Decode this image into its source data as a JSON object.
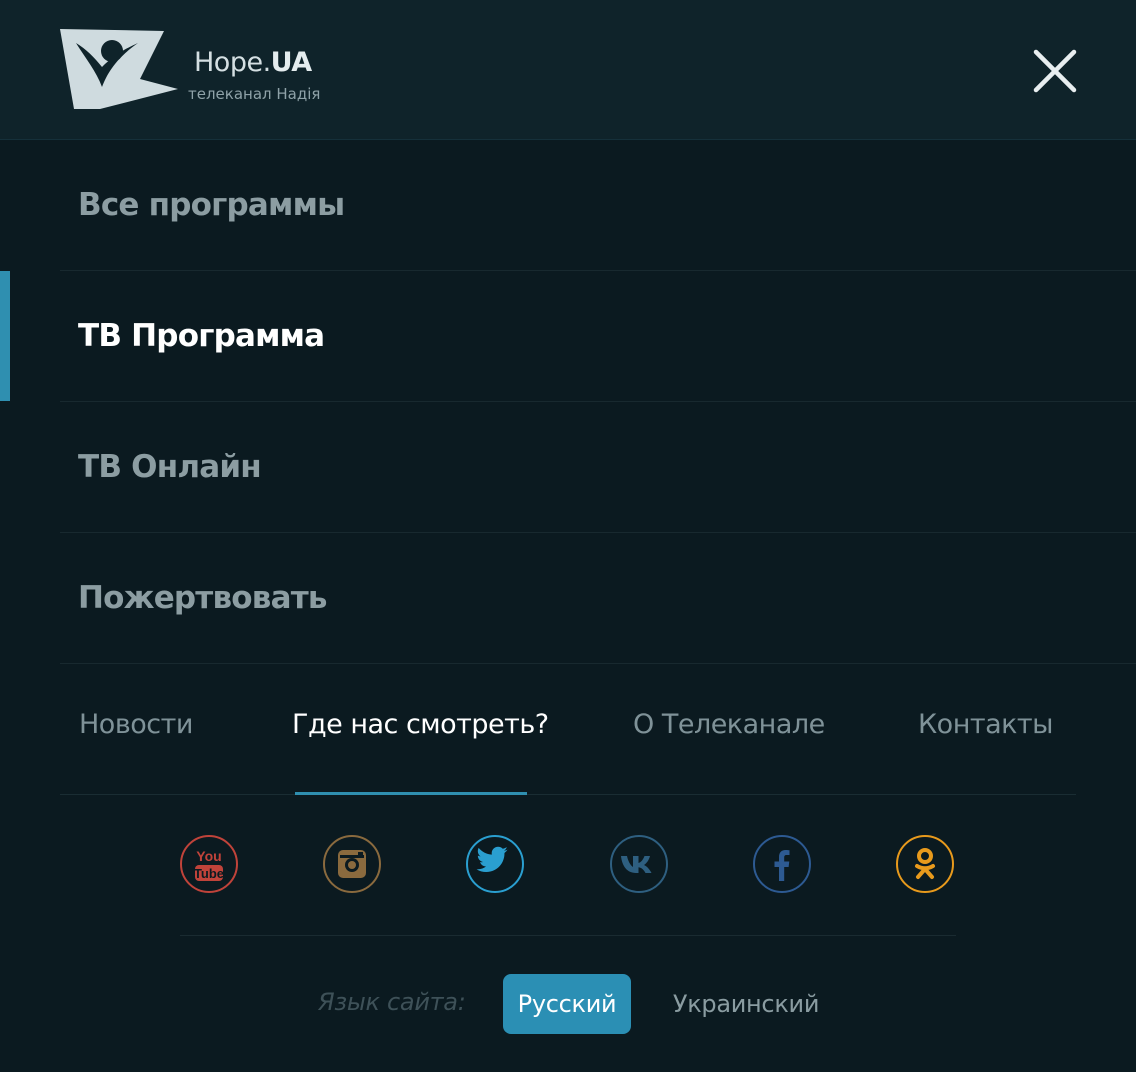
{
  "header": {
    "brand_name_main": "Hope.",
    "brand_name_accent": "UA",
    "brand_subtitle": "телеканал Надія",
    "close_icon": "close-icon"
  },
  "menu": {
    "items": [
      {
        "label": "Все программы",
        "active": false
      },
      {
        "label": "ТВ Программа",
        "active": true
      },
      {
        "label": "ТВ Онлайн",
        "active": false
      },
      {
        "label": "Пожертвовать",
        "active": false
      }
    ]
  },
  "subnav": {
    "items": [
      {
        "label": "Новости",
        "active": false
      },
      {
        "label": "Где нас смотреть?",
        "active": true
      },
      {
        "label": "О Телеканале",
        "active": false
      },
      {
        "label": "Контакты",
        "active": false
      }
    ]
  },
  "social": {
    "items": [
      {
        "icon": "youtube-icon",
        "color": "#c0433a"
      },
      {
        "icon": "instagram-icon",
        "color": "#8a6a3e"
      },
      {
        "icon": "twitter-icon",
        "color": "#2a9fd0"
      },
      {
        "icon": "vk-icon",
        "color": "#2e5f80"
      },
      {
        "icon": "facebook-icon",
        "color": "#2d5a92"
      },
      {
        "icon": "odnoklassniki-icon",
        "color": "#e89a1c"
      }
    ]
  },
  "language": {
    "label": "Язык сайта:",
    "options": [
      {
        "label": "Русский",
        "active": true
      },
      {
        "label": "Украинский",
        "active": false
      }
    ]
  },
  "colors": {
    "accent": "#2f8fb0",
    "background": "#0b1a20",
    "header_background": "#0f232a"
  }
}
